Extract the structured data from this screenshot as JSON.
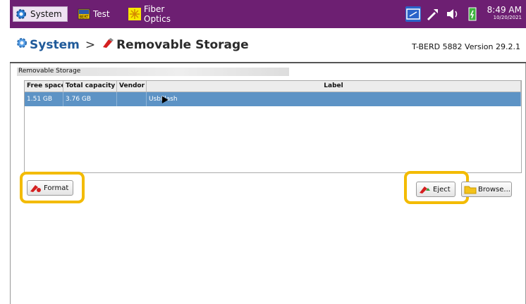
{
  "tabs": [
    {
      "label": "System",
      "icon": "gear-icon"
    },
    {
      "label": "Test",
      "icon": "bert-icon",
      "icon_text": "BERT"
    },
    {
      "label": "Fiber Optics",
      "icon": "fiber-icon"
    }
  ],
  "status": {
    "time": "8:49 AM",
    "date": "10/20/2021"
  },
  "breadcrumb": {
    "root": "System",
    "separator": ">",
    "current": "Removable Storage"
  },
  "version": "T-BERD 5882 Version 29.2.1",
  "panel_title": "Removable Storage",
  "table": {
    "columns": [
      "Free space",
      "Total capacity",
      "Vendor",
      "Label"
    ],
    "rows": [
      {
        "free": "1.51 GB",
        "total": "3.76 GB",
        "vendor": "",
        "label": "UsbFlash"
      }
    ]
  },
  "buttons": {
    "format": "Format",
    "eject": "Eject",
    "browse": "Browse..."
  },
  "colors": {
    "topbar": "#6d1f72",
    "selected_row": "#5d93c5",
    "highlight": "#f3bb00",
    "breadcrumb_root": "#1f5a9a"
  }
}
